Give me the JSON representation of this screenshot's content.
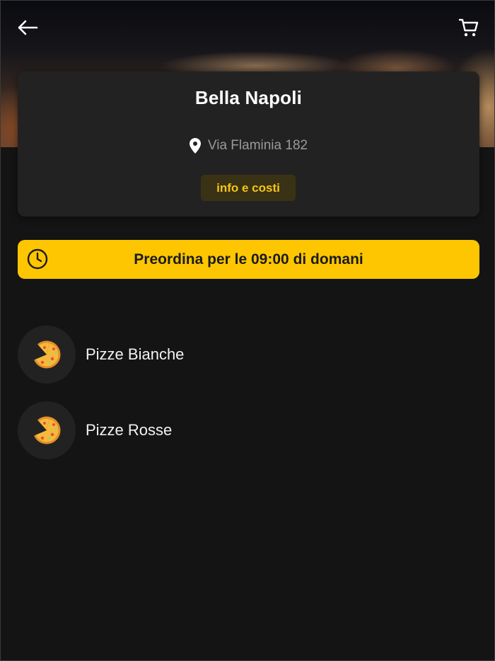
{
  "header": {
    "back_icon": "arrow-left-icon",
    "cart_icon": "shopping-cart-icon"
  },
  "restaurant": {
    "name": "Bella Napoli",
    "address": "Via Flaminia 182",
    "info_button_label": "info e costi"
  },
  "preorder": {
    "text_before": "Preordina per le",
    "time": "09:00",
    "text_after": "di domani"
  },
  "categories": [
    {
      "label": "Pizze Bianche",
      "icon": "pizza-icon"
    },
    {
      "label": "Pizze Rosse",
      "icon": "pizza-icon"
    }
  ],
  "colors": {
    "background": "#141414",
    "card": "#222222",
    "accent": "#fdc600",
    "info_button_bg": "#3a3214",
    "info_button_text": "#f5c518"
  }
}
